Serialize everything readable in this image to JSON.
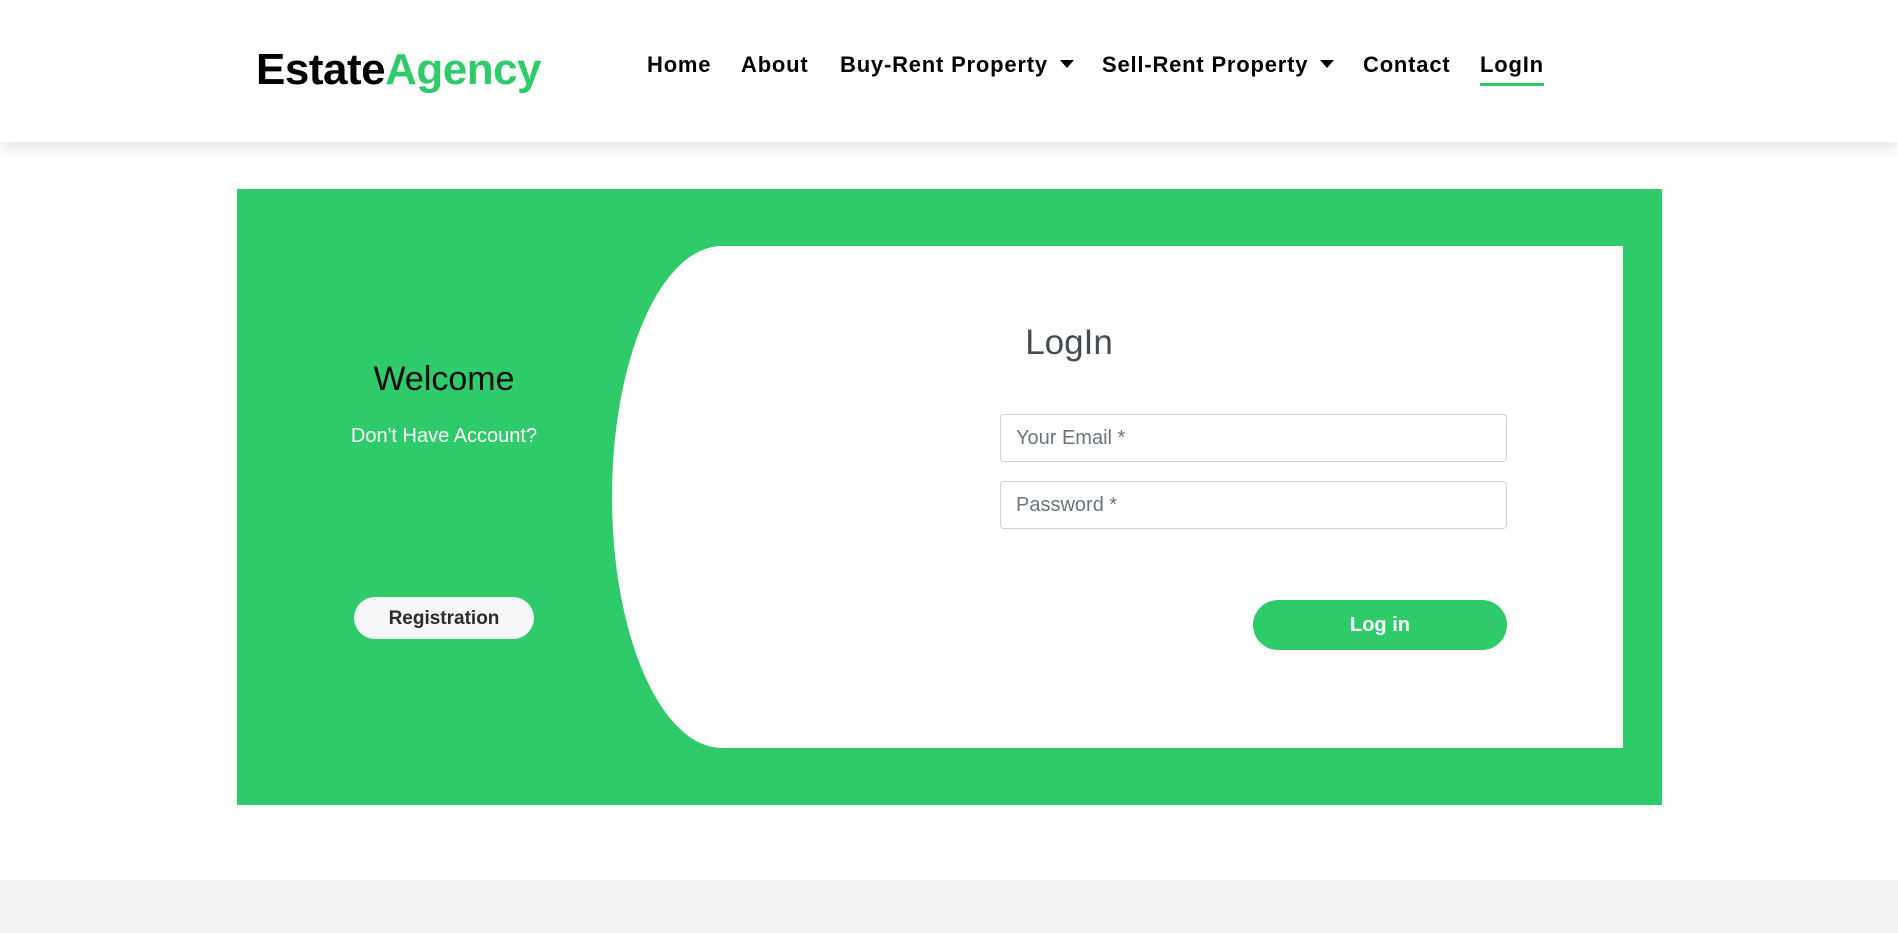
{
  "brand": {
    "logo_part1": "Estate",
    "logo_part2": "Agency"
  },
  "nav": {
    "items": [
      {
        "label": "Home"
      },
      {
        "label": "About"
      },
      {
        "label": "Buy-Rent Property",
        "dropdown": true
      },
      {
        "label": "Sell-Rent Property",
        "dropdown": true
      },
      {
        "label": "Contact"
      },
      {
        "label": "LogIn",
        "active": true
      }
    ]
  },
  "welcome_panel": {
    "title": "Welcome",
    "subtitle": "Don't Have Account?",
    "registration_label": "Registration"
  },
  "login_form": {
    "title": "LogIn",
    "email_placeholder": "Your Email *",
    "password_placeholder": "Password *",
    "submit_label": "Log in"
  },
  "colors": {
    "accent": "#2fcb6a",
    "text_dark": "#000000",
    "muted": "#6c757d"
  },
  "icons": {
    "dropdown": "caret-down-icon"
  }
}
